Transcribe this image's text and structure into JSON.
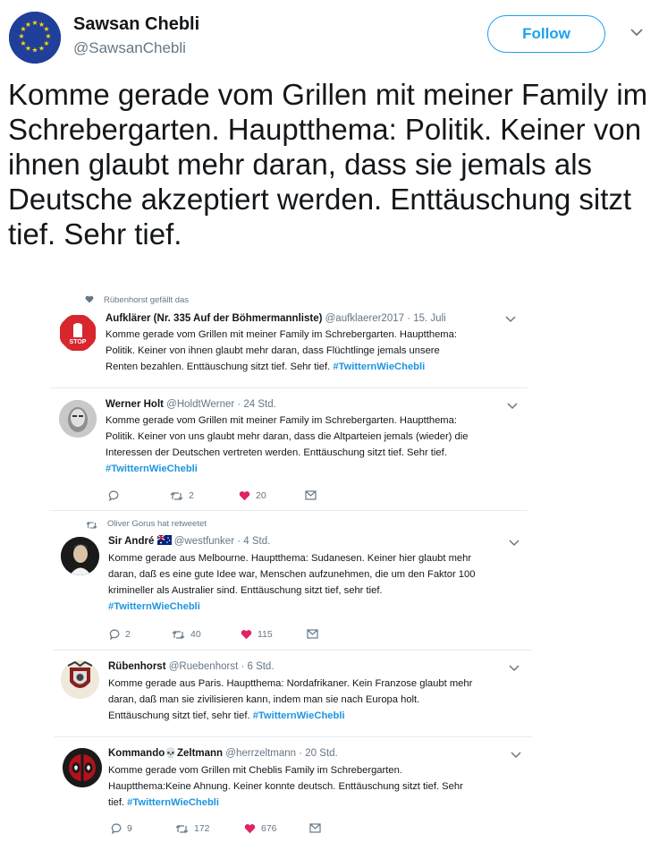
{
  "main_tweet": {
    "name": "Sawsan Chebli",
    "handle": "@SawsanChebli",
    "follow_label": "Follow",
    "text": "Komme gerade vom Grillen mit meiner Family im Schrebergarten. Hauptthema: Politik. Keiner von ihnen glaubt mehr daran, dass sie jemals als Deutsche akzeptiert werden. Enttäuschung sitzt tief. Sehr tief."
  },
  "replies": [
    {
      "context": "Rübenhorst gefällt das",
      "name": "Aufklärer (Nr. 335 Auf der Böhmermannliste)",
      "handle": "@aufklaerer2017 · 15. Juli",
      "lines": [
        "Komme gerade vom Grillen mit meiner Family im Schrebergarten. Hauptthema:",
        "Politik. Keiner von ihnen glaubt mehr daran, dass Flüchtlinge jemals unsere",
        "Renten bezahlen. Enttäuschung sitzt tief. Sehr tief."
      ],
      "hashtag": "#TwitternWieChebli",
      "avatar": "stop-sign-avatar"
    },
    {
      "name": "Werner Holt",
      "handle": "@HoldtWerner · 24 Std.",
      "lines": [
        "Komme gerade vom Grillen mit meiner Family im Schrebergarten. Hauptthema:",
        "Politik. Keiner von uns glaubt mehr daran, dass die Altparteien jemals (wieder) die",
        "Interessen der Deutschen vertreten werden. Enttäuschung sitzt tief. Sehr tief."
      ],
      "hashtag": "#TwitternWieChebli",
      "replies": "",
      "retweets": "2",
      "likes": "20"
    },
    {
      "context": "Oliver Gorus hat retweetet",
      "name": "Sir André",
      "handle": "@westfunker · 4 Std.",
      "lines": [
        "Komme gerade aus Melbourne. Hauptthema: Sudanesen. Keiner hier glaubt mehr",
        "daran, daß es eine gute Idee war, Menschen aufzunehmen, die um den Faktor 100",
        "krimineller als Australier sind. Enttäuschung sitzt tief, sehr tief."
      ],
      "hashtag": "#TwitternWieChebli",
      "replies": "2",
      "retweets": "40",
      "likes": "115"
    },
    {
      "name": "Rübenhorst",
      "handle": "@Ruebenhorst · 6 Std.",
      "lines": [
        "Komme gerade aus Paris. Hauptthema: Nordafrikaner. Kein Franzose glaubt mehr",
        "daran, daß man sie zivilisieren kann, indem man sie nach Europa holt."
      ],
      "last_line": "Enttäuschung sitzt tief, sehr tief.",
      "hashtag": "#TwitternWieChebli"
    },
    {
      "name_part1": "Kommando",
      "name_emoji": "💀",
      "name_part2": "Zeltmann",
      "handle": "@herrzeltmann · 20 Std.",
      "lines": [
        "Komme gerade vom Grillen mit Cheblis Family im Schrebergarten.",
        "Hauptthema:Keine Ahnung. Keiner konnte deutsch. Enttäuschung sitzt tief. Sehr"
      ],
      "last_line": "tief.",
      "hashtag": "#TwitternWieChebli",
      "replies": "9",
      "retweets": "172",
      "likes": "676"
    }
  ],
  "colors": {
    "accent": "#1da1f2",
    "hashtag": "#1b95e0",
    "like": "#e0245e",
    "muted": "#657786"
  }
}
